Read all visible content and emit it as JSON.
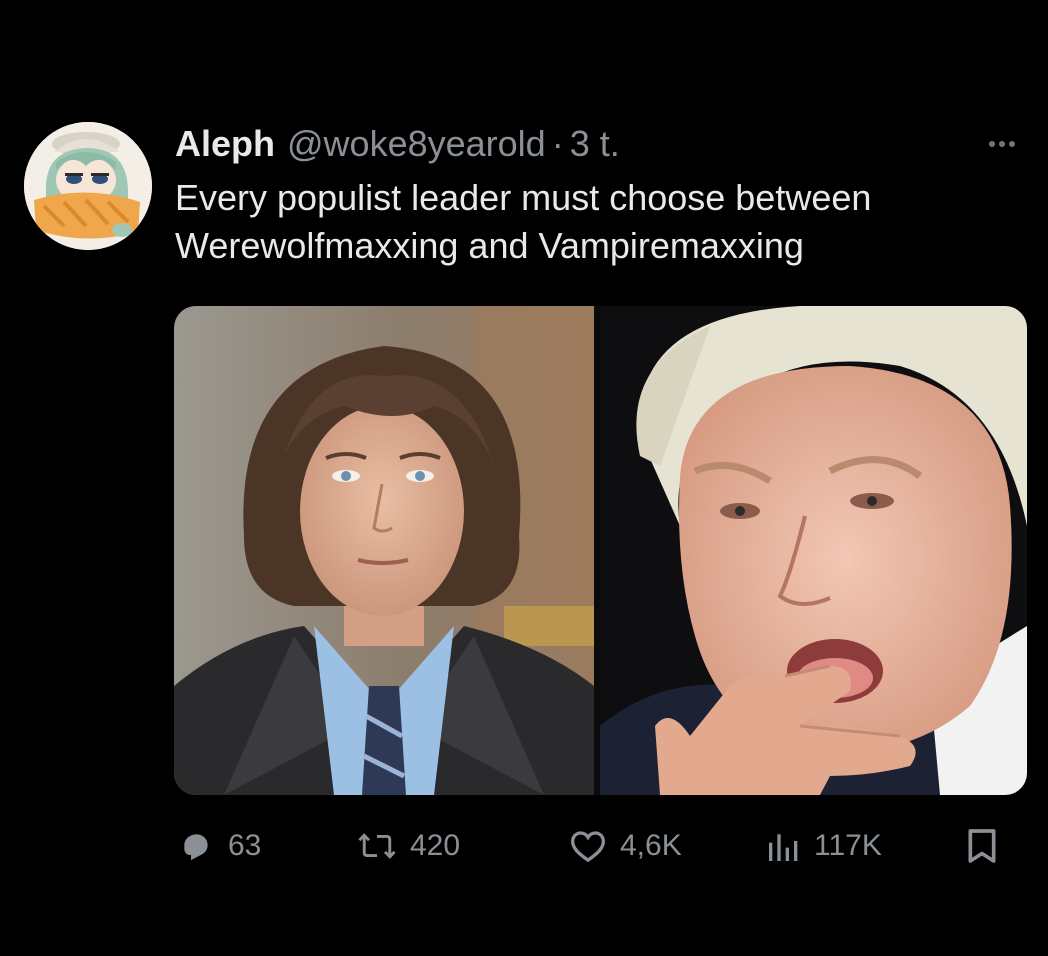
{
  "tweet": {
    "display_name": "Aleph",
    "handle": "@woke8yearold",
    "separator": "·",
    "timestamp": "3 t.",
    "text_lines": [
      "Every populist leader must choose between",
      "Werewolfmaxxing and Vampiremaxxing"
    ],
    "avatar_icon": "anime-character-avatar",
    "more_icon": "more-horizontal-icon"
  },
  "media": {
    "images": [
      {
        "icon": "photo-man-dark-leather-coat"
      },
      {
        "icon": "photo-man-white-hair-licking-fingers"
      }
    ]
  },
  "actions": {
    "reply": {
      "icon": "reply-icon",
      "count": "63"
    },
    "retweet": {
      "icon": "retweet-icon",
      "count": "420"
    },
    "like": {
      "icon": "heart-icon",
      "count": "4,6K"
    },
    "views": {
      "icon": "views-icon",
      "count": "117K"
    },
    "bookmark": {
      "icon": "bookmark-icon"
    }
  },
  "colors": {
    "background": "#000000",
    "primary_text": "#e7e9ea",
    "secondary_text": "#8b9096"
  }
}
